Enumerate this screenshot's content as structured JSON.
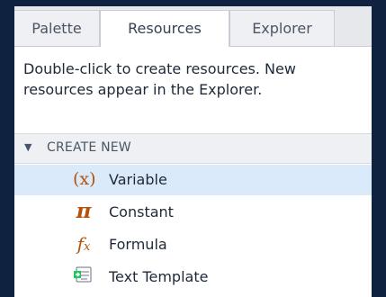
{
  "tabs": [
    {
      "label": "Palette"
    },
    {
      "label": "Resources"
    },
    {
      "label": "Explorer"
    }
  ],
  "description": "Double-click to create resources. New resources appear in the Explorer.",
  "section": {
    "label": "CREATE NEW"
  },
  "items": [
    {
      "icon": "variable-icon",
      "glyph": "(x)",
      "label": "Variable"
    },
    {
      "icon": "pi-icon",
      "glyph": "π",
      "label": "Constant"
    },
    {
      "icon": "fx-icon",
      "glyph": "fx",
      "label": "Formula"
    },
    {
      "icon": "text-template-icon",
      "glyph": "",
      "label": "Text Template"
    }
  ],
  "colors": {
    "window_background": "#0f2340",
    "selected_row": "#dbeafb",
    "icon_orange": "#b45309"
  }
}
